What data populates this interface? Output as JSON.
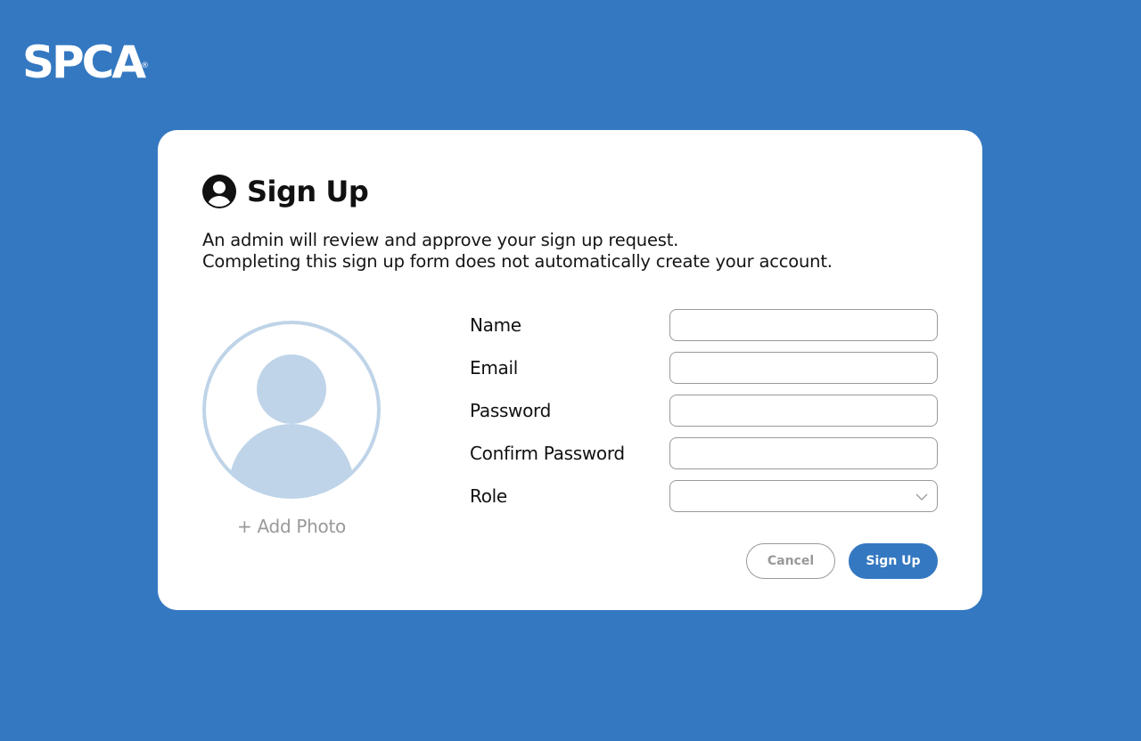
{
  "brand": {
    "logo_text": "SPCA",
    "registered_mark": "®"
  },
  "header": {
    "title": "Sign Up",
    "icon": "user-circle-icon",
    "description_line1": "An admin will review and approve your sign up request.",
    "description_line2": "Completing this sign up form does not automatically create your account."
  },
  "avatar": {
    "icon": "avatar-placeholder-icon",
    "add_photo_label": "+ Add Photo"
  },
  "form": {
    "fields": [
      {
        "label": "Name",
        "value": "",
        "placeholder": ""
      },
      {
        "label": "Email",
        "value": "",
        "placeholder": ""
      },
      {
        "label": "Password",
        "value": "",
        "placeholder": ""
      },
      {
        "label": "Confirm Password",
        "value": "",
        "placeholder": ""
      },
      {
        "label": "Role",
        "value": "",
        "placeholder": ""
      }
    ]
  },
  "buttons": {
    "cancel_label": "Cancel",
    "signup_label": "Sign Up"
  },
  "colors": {
    "background": "#3478c1",
    "card": "#ffffff",
    "accent": "#3478c1",
    "avatar_fill": "#bfd4e8",
    "muted_text": "#999999"
  }
}
